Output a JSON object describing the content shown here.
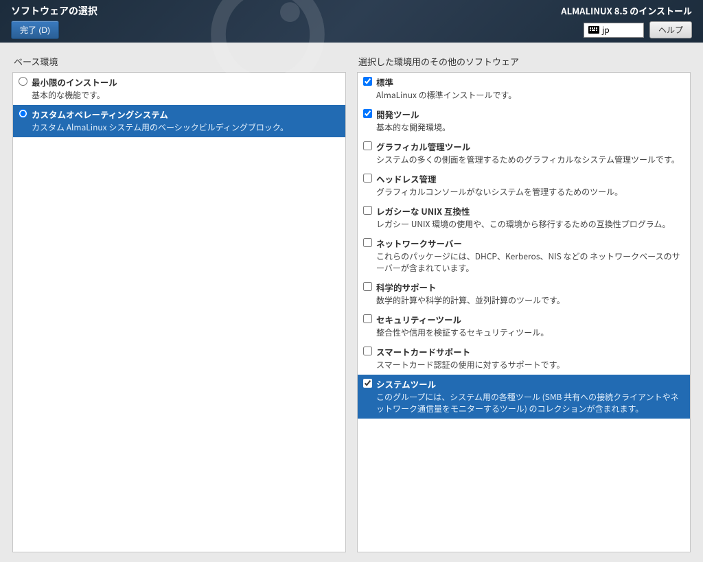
{
  "header": {
    "title": "ソフトウェアの選択",
    "done_label": "完了 (D)",
    "install_title": "ALMALINUX 8.5 のインストール",
    "keyboard": "jp",
    "help_label": "ヘルプ"
  },
  "left": {
    "heading": "ベース環境",
    "items": [
      {
        "title": "最小限のインストール",
        "desc": "基本的な機能です。",
        "selected": false
      },
      {
        "title": "カスタムオペレーティングシステム",
        "desc": "カスタム AlmaLinux システム用のベーシックビルディングブロック。",
        "selected": true
      }
    ]
  },
  "right": {
    "heading": "選択した環境用のその他のソフトウェア",
    "items": [
      {
        "title": "標準",
        "desc": "AlmaLinux の標準インストールです。",
        "checked": true,
        "selected": false
      },
      {
        "title": "開発ツール",
        "desc": "基本的な開発環境。",
        "checked": true,
        "selected": false
      },
      {
        "title": "グラフィカル管理ツール",
        "desc": "システムの多くの側面を管理するためのグラフィカルなシステム管理ツールです。",
        "checked": false,
        "selected": false
      },
      {
        "title": "ヘッドレス管理",
        "desc": "グラフィカルコンソールがないシステムを管理するためのツール。",
        "checked": false,
        "selected": false
      },
      {
        "title": "レガシーな UNIX 互換性",
        "desc": "レガシー UNIX 環境の使用や、この環境から移行するための互換性プログラム。",
        "checked": false,
        "selected": false
      },
      {
        "title": "ネットワークサーバー",
        "desc": "これらのパッケージには、DHCP、Kerberos、NIS などの ネットワークベースのサーバーが含まれています。",
        "checked": false,
        "selected": false
      },
      {
        "title": "科学的サポート",
        "desc": "数学的計算や科学的計算、並列計算のツールです。",
        "checked": false,
        "selected": false
      },
      {
        "title": "セキュリティーツール",
        "desc": "整合性や信用を検証するセキュリティツール。",
        "checked": false,
        "selected": false
      },
      {
        "title": "スマートカードサポート",
        "desc": "スマートカード認証の使用に対するサポートです。",
        "checked": false,
        "selected": false
      },
      {
        "title": "システムツール",
        "desc": "このグループには、システム用の各種ツール (SMB 共有への接続クライアントやネットワーク通信量をモニターするツール) のコレクションが含まれます。",
        "checked": true,
        "selected": true
      }
    ]
  }
}
